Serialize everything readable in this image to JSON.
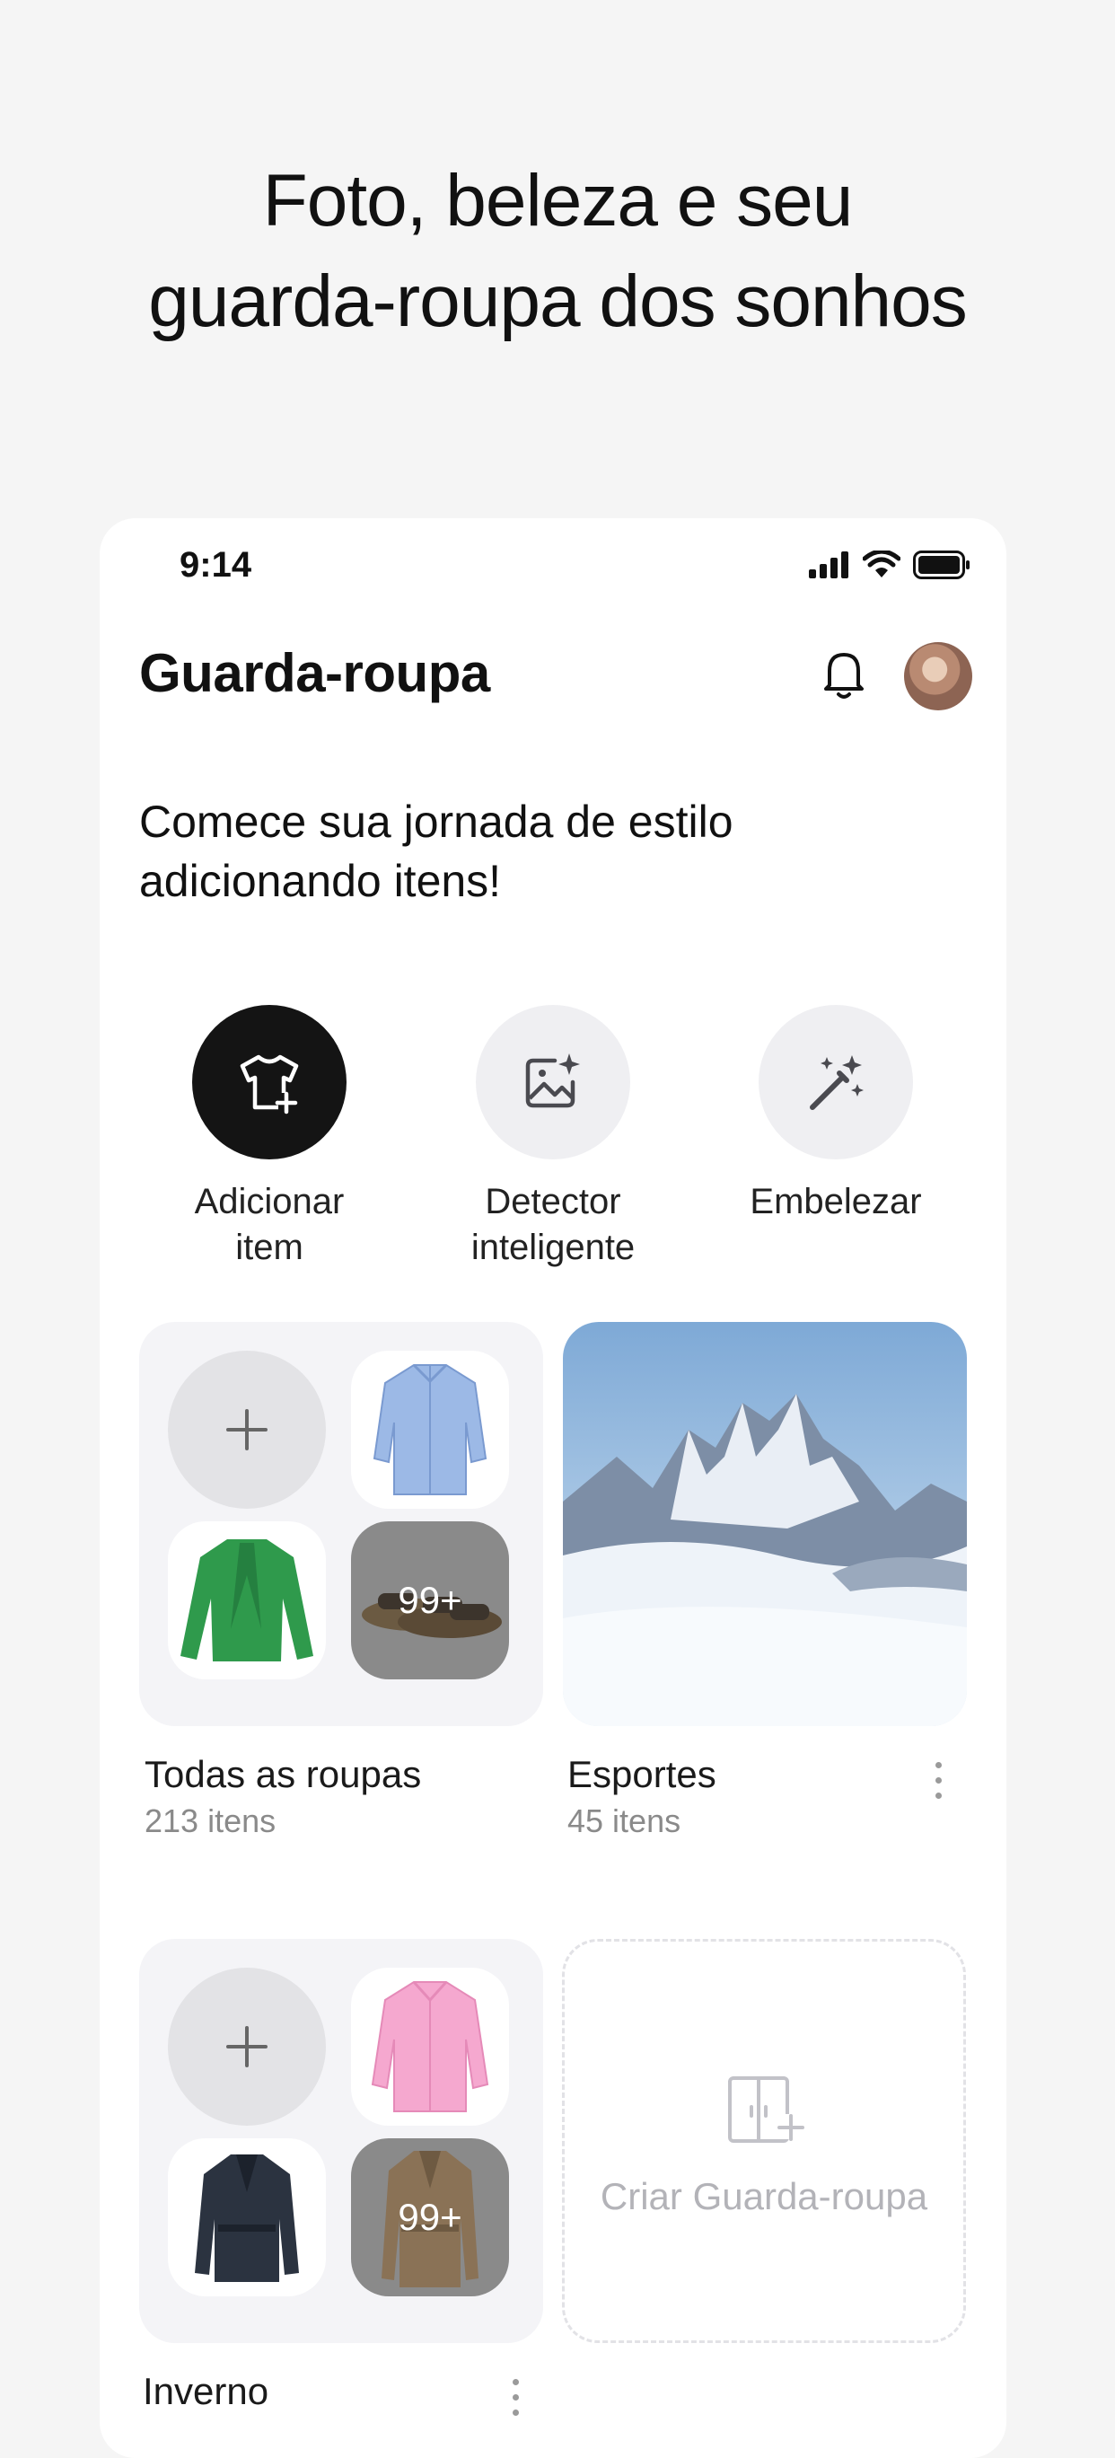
{
  "headline": {
    "line1": "Foto, beleza e seu",
    "line2": "guarda-roupa dos sonhos"
  },
  "status_bar": {
    "time": "9:14"
  },
  "header": {
    "title": "Guarda-roupa"
  },
  "intro": {
    "line1": "Comece sua jornada de estilo",
    "line2": "adicionando itens!"
  },
  "actions": [
    {
      "line1": "Adicionar",
      "line2": "item",
      "icon": "tshirt-plus-icon"
    },
    {
      "line1": "Detector",
      "line2": "inteligente",
      "icon": "image-sparkle-icon"
    },
    {
      "line1": "Embelezar",
      "line2": "",
      "icon": "magic-wand-icon"
    }
  ],
  "wardrobes": [
    {
      "title": "Todas as roupas",
      "count": "213 itens",
      "more": "99+"
    },
    {
      "title": "Esportes",
      "count": "45 itens"
    },
    {
      "title": "Inverno",
      "more": "99+"
    }
  ],
  "create": {
    "label": "Criar Guarda-roupa"
  },
  "colors": {
    "accent_dark": "#141414",
    "muted": "#8a8a8a",
    "card_bg": "#f4f4f7"
  }
}
